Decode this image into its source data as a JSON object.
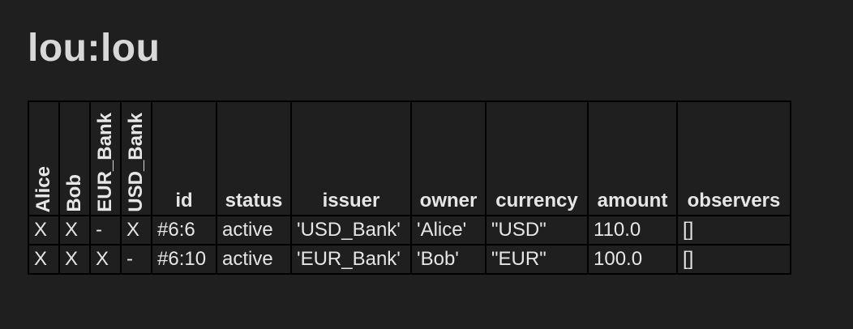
{
  "page": {
    "title": "lou:lou"
  },
  "table": {
    "party_headers": [
      "Alice",
      "Bob",
      "EUR_Bank",
      "USD_Bank"
    ],
    "field_headers": [
      "id",
      "status",
      "issuer",
      "owner",
      "currency",
      "amount",
      "observers"
    ],
    "rows": [
      {
        "marks": [
          "X",
          "X",
          "-",
          "X"
        ],
        "id": "#6:6",
        "status": "active",
        "issuer": "'USD_Bank'",
        "owner": "'Alice'",
        "currency": "\"USD\"",
        "amount": "110.0",
        "observers": "[]"
      },
      {
        "marks": [
          "X",
          "X",
          "X",
          "-"
        ],
        "id": "#6:10",
        "status": "active",
        "issuer": "'EUR_Bank'",
        "owner": "'Bob'",
        "currency": "\"EUR\"",
        "amount": "100.0",
        "observers": "[]"
      }
    ]
  },
  "colors": {
    "background": "#1f1f1f",
    "text": "#e6e6e6",
    "border": "#000000"
  }
}
